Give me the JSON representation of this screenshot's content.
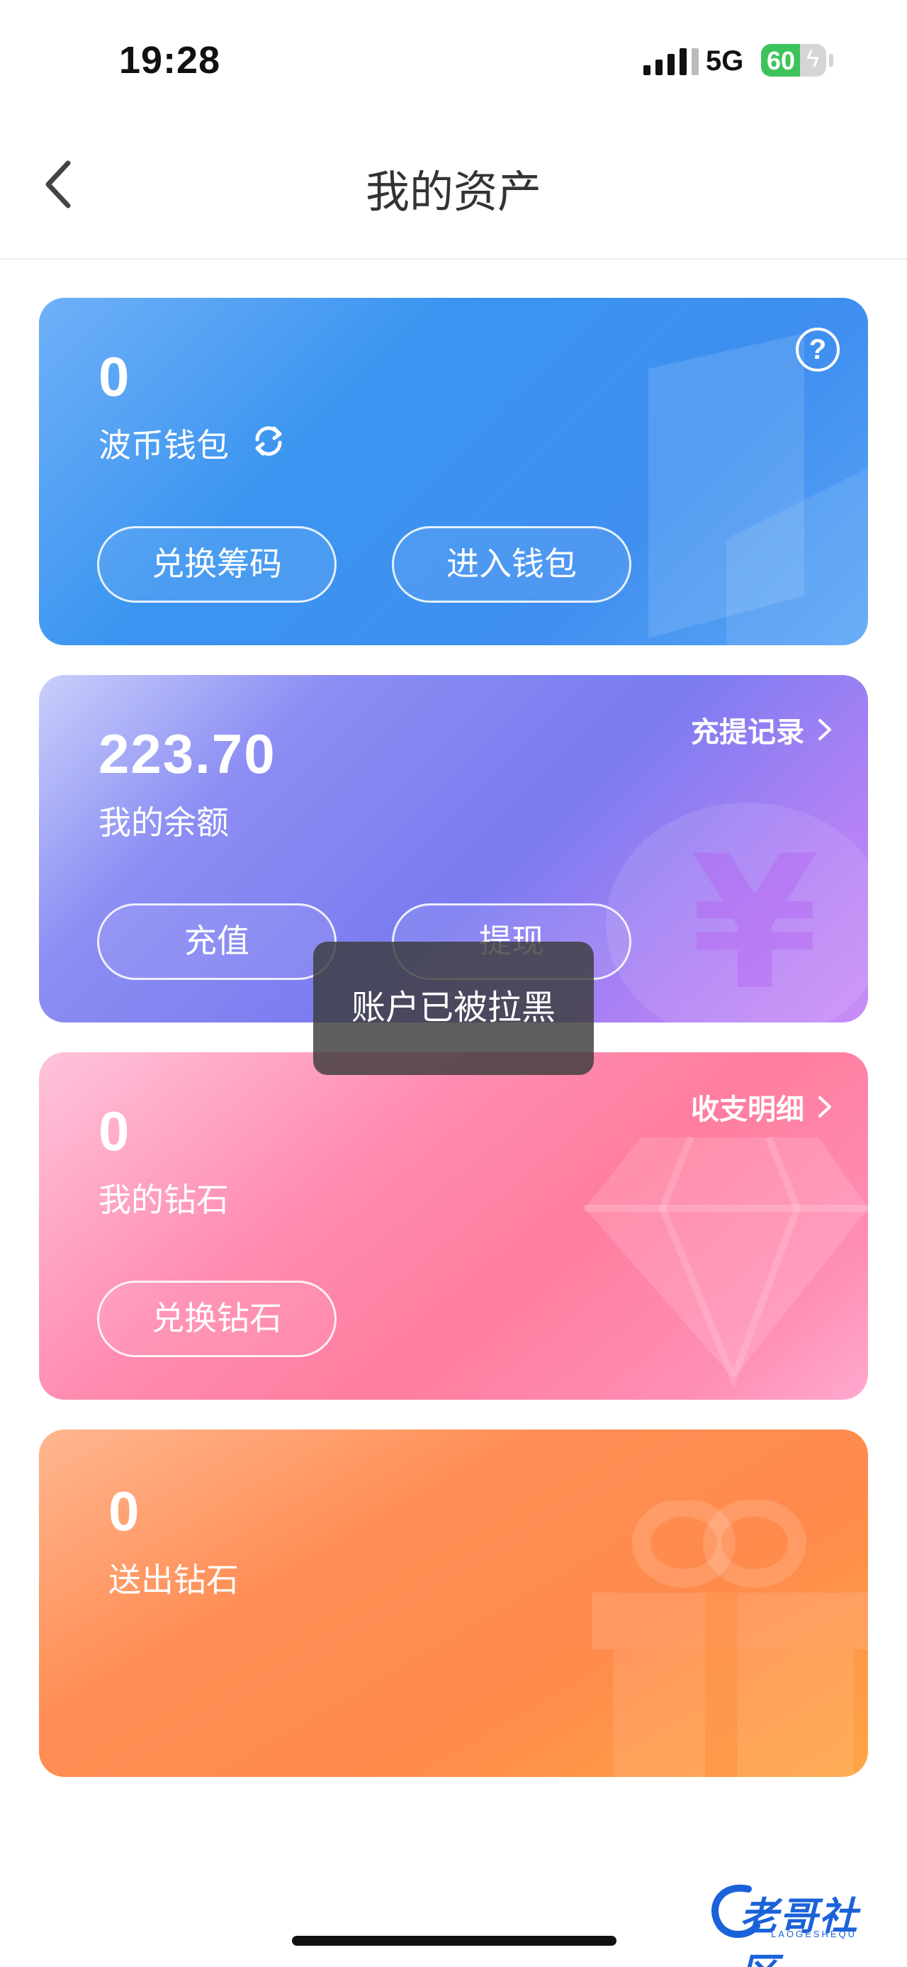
{
  "status_bar": {
    "time": "19:28",
    "network": "5G",
    "battery": "60",
    "battery_level": 0.6
  },
  "nav": {
    "title": "我的资产"
  },
  "cards": {
    "bocoin": {
      "value": "0",
      "label": "波币钱包",
      "buttons": [
        "兑换筹码",
        "进入钱包"
      ]
    },
    "balance": {
      "value": "223.70",
      "label": "我的余额",
      "link": "充提记录",
      "buttons": [
        "充值",
        "提现"
      ]
    },
    "diamonds": {
      "value": "0",
      "label": "我的钻石",
      "link": "收支明细",
      "buttons": [
        "兑换钻石"
      ]
    },
    "sent": {
      "value": "0",
      "label": "送出钻石"
    }
  },
  "toast": {
    "message": "账户已被拉黑"
  },
  "watermark": {
    "text": "老哥社区",
    "sub": "LAOGESHEQU"
  },
  "colors": {
    "blue_card": "#3f8ff0",
    "purple_card": "#7a7cf0",
    "pink_card": "#ff7d9f",
    "orange_card": "#ff8a4c",
    "watermark": "#1a62d9"
  },
  "icons": {
    "back": "chevron-left-icon",
    "refresh": "refresh-icon",
    "help": "question-circle-icon",
    "link_chevron": "chevron-right-icon"
  }
}
